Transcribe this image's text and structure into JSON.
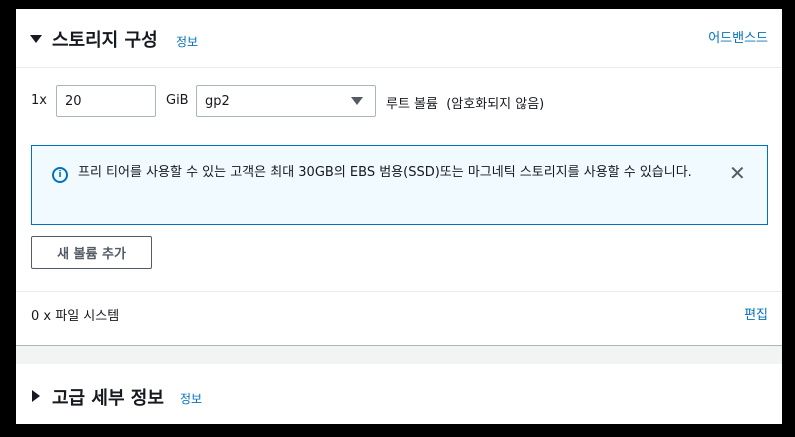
{
  "storage": {
    "title": "스토리지 구성",
    "info": "정보",
    "advanced": "어드밴스드",
    "count": "1x",
    "size": "20",
    "unit": "GiB",
    "volume_type": "gp2",
    "volume_desc": "루트 볼륨  (암호화되지 않음)",
    "alert_text": "프리 티어를 사용할 수 있는 고객은 최대 30GB의 EBS 범용(SSD)또는 마그네틱 스토리지를 사용할 수 있습니다.",
    "add_volume": "새 볼륨 추가",
    "filesystems": "0 x 파일 시스템",
    "edit": "편집"
  },
  "advanced_details": {
    "title": "고급 세부 정보",
    "info": "정보"
  },
  "icons": {
    "info_icon": "info-circle-icon",
    "close_icon": "close-icon"
  }
}
